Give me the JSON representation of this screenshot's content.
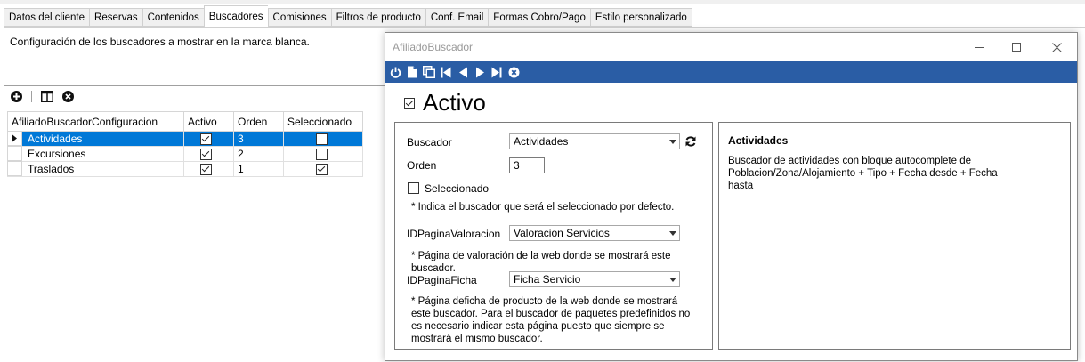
{
  "tabs": [
    {
      "label": "Datos del cliente"
    },
    {
      "label": "Reservas"
    },
    {
      "label": "Contenidos"
    },
    {
      "label": "Buscadores",
      "active": true
    },
    {
      "label": "Comisiones"
    },
    {
      "label": "Filtros de producto"
    },
    {
      "label": "Conf. Email"
    },
    {
      "label": "Formas Cobro/Pago"
    },
    {
      "label": "Estilo personalizado"
    }
  ],
  "panel": {
    "description": "Configuración de los buscadores a mostrar en la marca blanca."
  },
  "grid": {
    "columns": [
      "AfiliadoBuscadorConfiguracion",
      "Activo",
      "Orden",
      "Seleccionado"
    ],
    "rows": [
      {
        "name": "Actividades",
        "activo": true,
        "orden": "3",
        "seleccionado": false,
        "selected": true
      },
      {
        "name": "Excursiones",
        "activo": true,
        "orden": "2",
        "seleccionado": false
      },
      {
        "name": "Traslados",
        "activo": true,
        "orden": "1",
        "seleccionado": true
      }
    ]
  },
  "dialog": {
    "title": "AfiliadoBuscador",
    "activo_label": "Activo",
    "activo_checked": true,
    "buscador_label": "Buscador",
    "buscador_value": "Actividades",
    "orden_label": "Orden",
    "orden_value": "3",
    "seleccionado_label": "Seleccionado",
    "seleccionado_checked": false,
    "seleccionado_note": "* Indica el buscador que será el seleccionado por defecto.",
    "valoracion_label": "IDPaginaValoracion",
    "valoracion_value": "Valoracion Servicios",
    "valoracion_note": "* Página de valoración de la web donde se mostrará este buscador.",
    "ficha_label": "IDPaginaFicha",
    "ficha_value": "Ficha Servicio",
    "ficha_note": "* Página deficha de producto de la web donde se mostrará este buscador. Para el buscador de paquetes predefinidos no es necesario indicar esta página puesto que siempre se mostrará el mismo buscador.",
    "info_title": "Actividades",
    "info_text": "Buscador de actividades con bloque autocomplete de Poblacion/Zona/Alojamiento + Tipo + Fecha desde + Fecha hasta"
  },
  "colors": {
    "toolbar_blue": "#2a5da5",
    "selection_blue": "#0078d7"
  }
}
